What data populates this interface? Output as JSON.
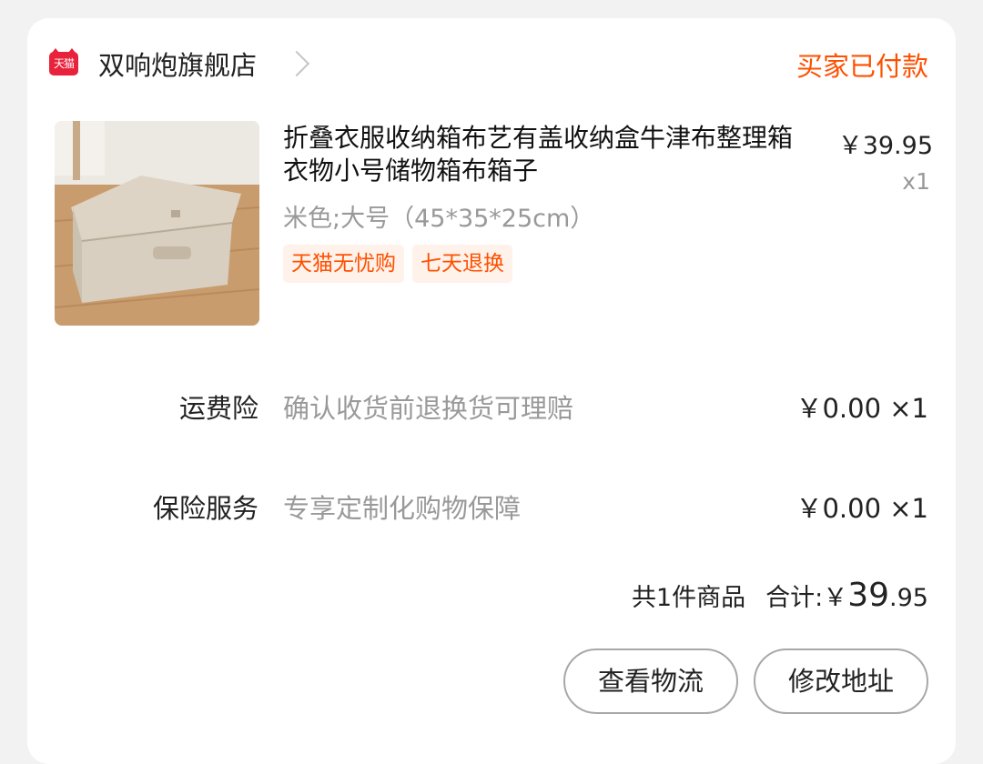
{
  "store": {
    "logo_text": "天猫",
    "logo_icon": "tmall-icon",
    "name": "双响炮旗舰店",
    "chevron_icon": "chevron-right-icon"
  },
  "order_status": "买家已付款",
  "product": {
    "title": "折叠衣服收纳箱布艺有盖收纳盒牛津布整理箱衣物小号储物箱布箱子",
    "spec": "米色;大号（45*35*25cm）",
    "tags": [
      "天猫无忧购",
      "七天退换"
    ],
    "price": "￥39.95",
    "quantity": "x1"
  },
  "services": [
    {
      "label": "运费险",
      "desc": "确认收货前退换货可理赔",
      "price": "￥0.00 ×1"
    },
    {
      "label": "保险服务",
      "desc": "专享定制化购物保障",
      "price": "￥0.00 ×1"
    }
  ],
  "summary": {
    "count_text": "共1件商品",
    "total_label": "合计:",
    "currency": "￥",
    "total_integer": "39",
    "total_decimal": ".95"
  },
  "buttons": {
    "logistics": "查看物流",
    "address": "修改地址"
  },
  "colors": {
    "accent": "#ff5000",
    "tmall_red": "#e8223b",
    "tag_bg": "#fff2ea"
  }
}
